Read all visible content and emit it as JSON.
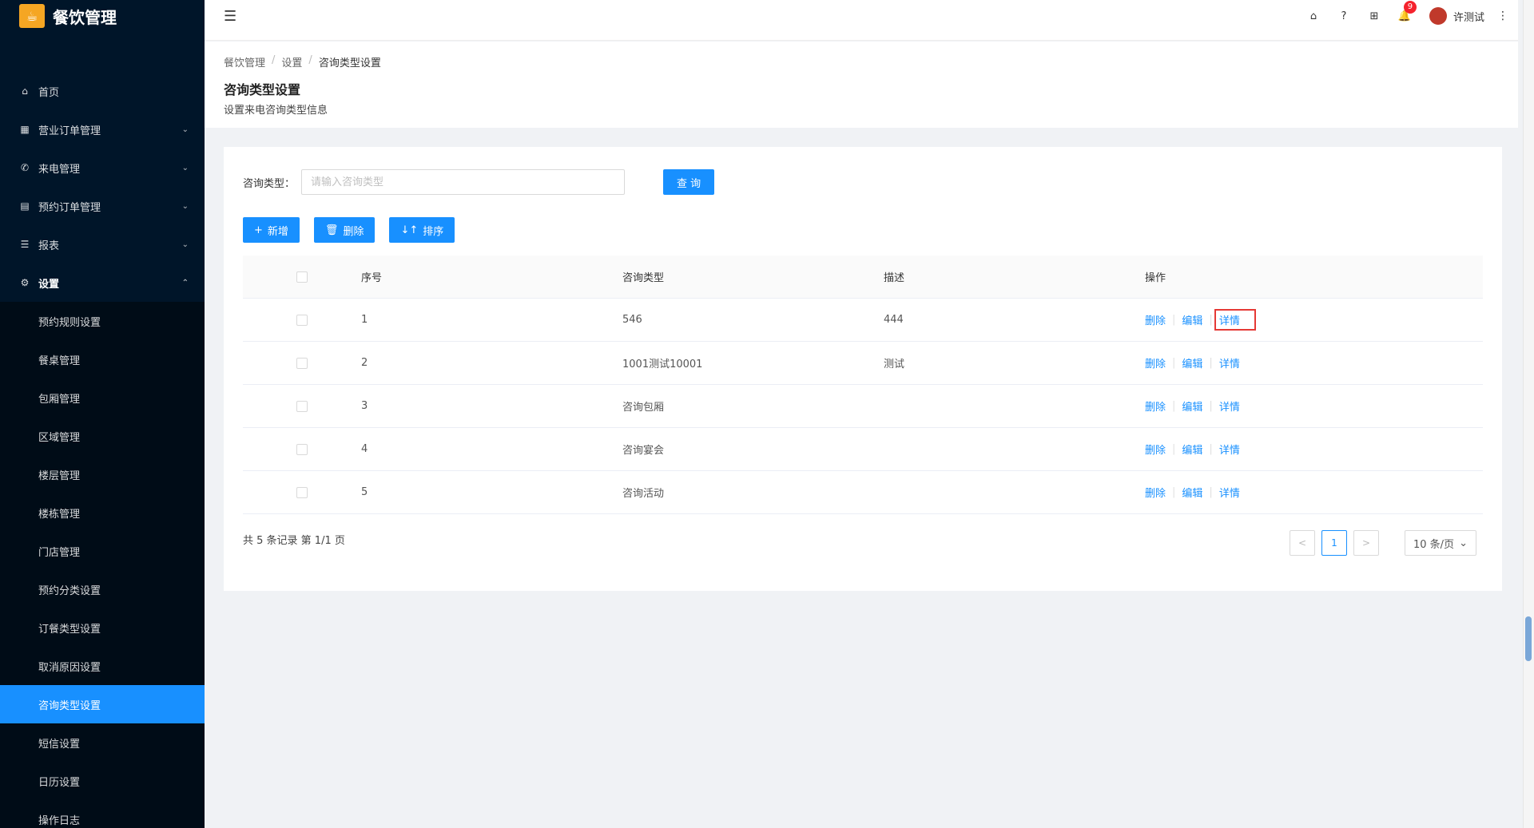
{
  "app": {
    "logo_glyph": "☕",
    "title": "餐饮管理"
  },
  "sidebar": {
    "items": [
      {
        "label": "首页",
        "icon": "⌂",
        "arrow": ""
      },
      {
        "label": "营业订单管理",
        "icon": "▦",
        "arrow": "⌄"
      },
      {
        "label": "来电管理",
        "icon": "✆",
        "arrow": "⌄"
      },
      {
        "label": "预约订单管理",
        "icon": "▤",
        "arrow": "⌄"
      },
      {
        "label": "报表",
        "icon": "☰",
        "arrow": "⌄"
      },
      {
        "label": "设置",
        "icon": "⚙",
        "arrow": "⌃"
      }
    ],
    "sub_items": [
      "预约规则设置",
      "餐桌管理",
      "包厢管理",
      "区域管理",
      "楼层管理",
      "楼栋管理",
      "门店管理",
      "预约分类设置",
      "订餐类型设置",
      "取消原因设置",
      "咨询类型设置",
      "短信设置",
      "日历设置",
      "操作日志"
    ]
  },
  "header": {
    "collapse_icon": "☰",
    "home_icon": "⌂",
    "help_icon": "?",
    "apps_icon": "⊞",
    "bell_icon": "🔔",
    "notification_count": "9",
    "username": "许测试",
    "more_icon": "⋮"
  },
  "breadcrumb": {
    "items": [
      "餐饮管理",
      "设置",
      "咨询类型设置"
    ],
    "sep": "/"
  },
  "page": {
    "title": "咨询类型设置",
    "description": "设置来电咨询类型信息"
  },
  "search": {
    "label": "咨询类型：",
    "placeholder": "请输入咨询类型",
    "value": "",
    "query_button": "查 询"
  },
  "actions": {
    "add": {
      "icon": "+",
      "label": "新增"
    },
    "delete": {
      "icon": "🗑",
      "label": "删除"
    },
    "sort": {
      "icon": "↓↑",
      "label": "排序"
    }
  },
  "table": {
    "headers": {
      "no": "序号",
      "type": "咨询类型",
      "desc": "描述",
      "ops": "操作"
    },
    "rows": [
      {
        "no": "1",
        "type": "546",
        "desc": "444"
      },
      {
        "no": "2",
        "type": "1001测试10001",
        "desc": "测试"
      },
      {
        "no": "3",
        "type": "咨询包厢",
        "desc": ""
      },
      {
        "no": "4",
        "type": "咨询宴会",
        "desc": ""
      },
      {
        "no": "5",
        "type": "咨询活动",
        "desc": ""
      }
    ],
    "op_labels": {
      "delete": "删除",
      "edit": "编辑",
      "detail": "详情"
    }
  },
  "footer": {
    "summary": "共 5 条记录 第 1/1 页"
  },
  "pagination": {
    "prev": "<",
    "current": "1",
    "next": ">",
    "page_size": "10 条/页",
    "page_size_arrow": "⌄"
  },
  "colors": {
    "primary": "#1890ff",
    "sidebar_bg": "#001529",
    "highlight_box": "#e53935",
    "badge": "#f5222d"
  }
}
